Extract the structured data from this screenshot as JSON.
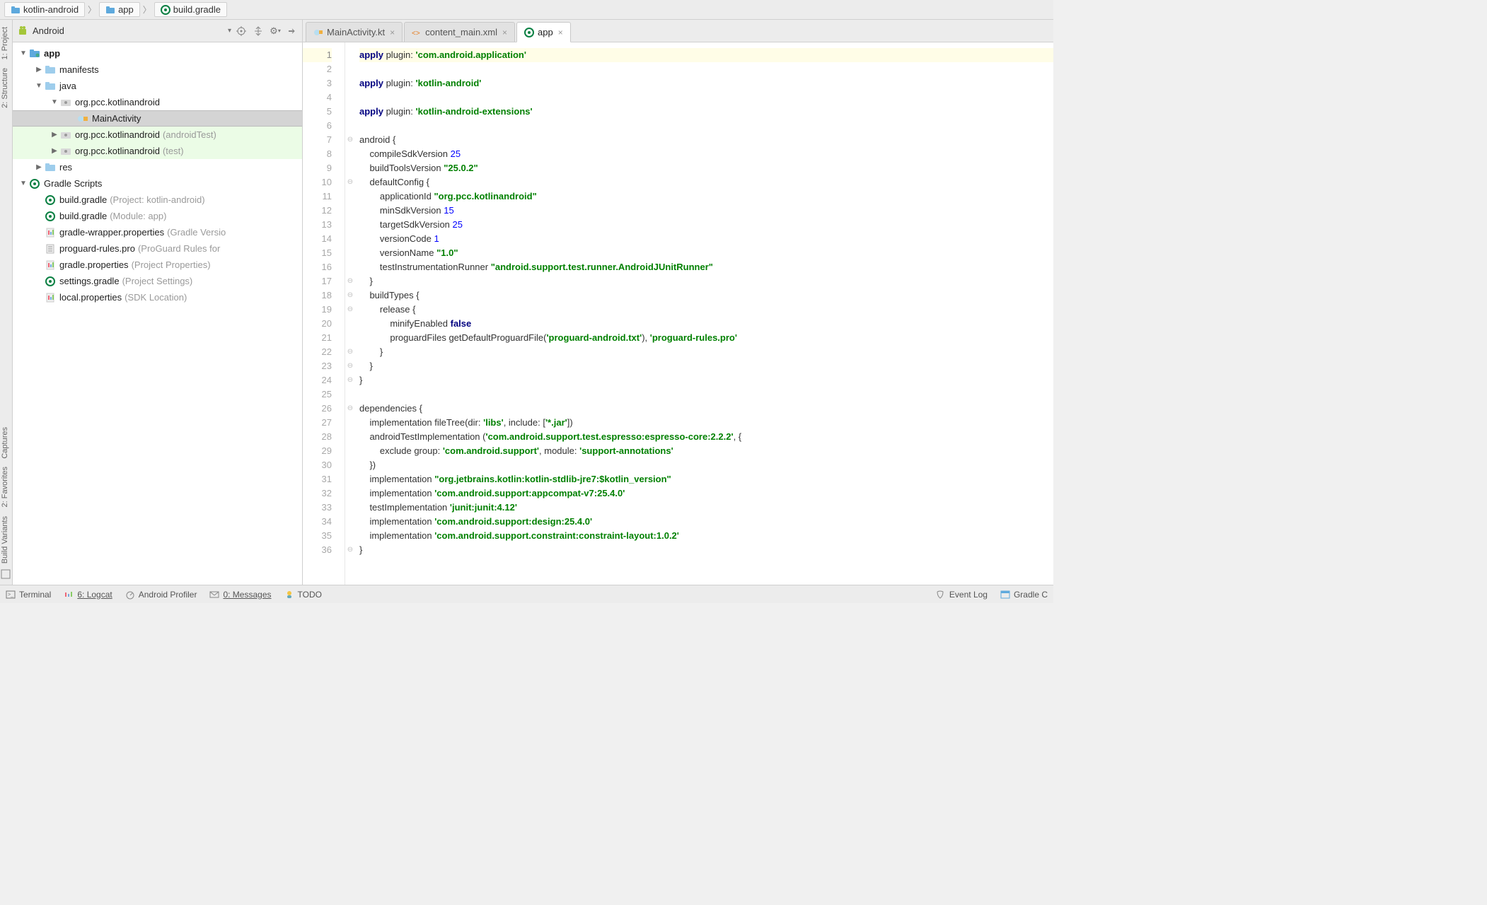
{
  "breadcrumbs": [
    {
      "label": "kotlin-android",
      "icon": "folder-blue"
    },
    {
      "label": "app",
      "icon": "folder-blue"
    },
    {
      "label": "build.gradle",
      "icon": "gradle"
    }
  ],
  "sidebar": {
    "dropdown_label": "Android",
    "toolbuttons": [
      "target-icon",
      "sync-icon",
      "gear-icon",
      "collapse-icon"
    ]
  },
  "tree": {
    "app": "app",
    "manifests": "manifests",
    "java": "java",
    "pkg_main": "org.pcc.kotlinandroid",
    "main_activity": "MainActivity",
    "pkg_androidTest": "org.pcc.kotlinandroid",
    "pkg_androidTest_suffix": "(androidTest)",
    "pkg_test": "org.pcc.kotlinandroid",
    "pkg_test_suffix": "(test)",
    "res": "res",
    "gradle_scripts": "Gradle Scripts",
    "build_project": "build.gradle",
    "build_project_suffix": "(Project: kotlin-android)",
    "build_module": "build.gradle",
    "build_module_suffix": "(Module: app)",
    "gradle_wrapper": "gradle-wrapper.properties",
    "gradle_wrapper_suffix": "(Gradle Versio",
    "proguard": "proguard-rules.pro",
    "proguard_suffix": "(ProGuard Rules for",
    "gradle_props": "gradle.properties",
    "gradle_props_suffix": "(Project Properties)",
    "settings_gradle": "settings.gradle",
    "settings_gradle_suffix": "(Project Settings)",
    "local_props": "local.properties",
    "local_props_suffix": "(SDK Location)"
  },
  "editor_tabs": [
    {
      "label": "MainActivity.kt",
      "icon": "kotlin",
      "active": false
    },
    {
      "label": "content_main.xml",
      "icon": "xml",
      "active": false
    },
    {
      "label": "app",
      "icon": "gradle",
      "active": true
    }
  ],
  "code": {
    "lines": [
      {
        "n": 1,
        "curr": true,
        "tokens": [
          [
            "apply ",
            "k"
          ],
          [
            "plugin",
            ""
          ],
          [
            ": ",
            ""
          ],
          [
            "'com.android.application'",
            "s"
          ]
        ]
      },
      {
        "n": 2,
        "tokens": [
          [
            "",
            ""
          ]
        ]
      },
      {
        "n": 3,
        "tokens": [
          [
            "apply ",
            "k"
          ],
          [
            "plugin",
            ""
          ],
          [
            ": ",
            ""
          ],
          [
            "'kotlin-android'",
            "s"
          ]
        ]
      },
      {
        "n": 4,
        "tokens": [
          [
            "",
            ""
          ]
        ]
      },
      {
        "n": 5,
        "tokens": [
          [
            "apply ",
            "k"
          ],
          [
            "plugin",
            ""
          ],
          [
            ": ",
            ""
          ],
          [
            "'kotlin-android-extensions'",
            "s"
          ]
        ]
      },
      {
        "n": 6,
        "tokens": [
          [
            "",
            ""
          ]
        ]
      },
      {
        "n": 7,
        "tokens": [
          [
            "android {",
            ""
          ]
        ]
      },
      {
        "n": 8,
        "tokens": [
          [
            "    compileSdkVersion ",
            ""
          ],
          [
            "25",
            "n"
          ]
        ]
      },
      {
        "n": 9,
        "tokens": [
          [
            "    buildToolsVersion ",
            ""
          ],
          [
            "\"25.0.2\"",
            "s"
          ]
        ]
      },
      {
        "n": 10,
        "tokens": [
          [
            "    defaultConfig {",
            ""
          ]
        ]
      },
      {
        "n": 11,
        "tokens": [
          [
            "        applicationId ",
            ""
          ],
          [
            "\"org.pcc.kotlinandroid\"",
            "s"
          ]
        ]
      },
      {
        "n": 12,
        "tokens": [
          [
            "        minSdkVersion ",
            ""
          ],
          [
            "15",
            "n"
          ]
        ]
      },
      {
        "n": 13,
        "tokens": [
          [
            "        targetSdkVersion ",
            ""
          ],
          [
            "25",
            "n"
          ]
        ]
      },
      {
        "n": 14,
        "tokens": [
          [
            "        versionCode ",
            ""
          ],
          [
            "1",
            "n"
          ]
        ]
      },
      {
        "n": 15,
        "tokens": [
          [
            "        versionName ",
            ""
          ],
          [
            "\"1.0\"",
            "s"
          ]
        ]
      },
      {
        "n": 16,
        "tokens": [
          [
            "        testInstrumentationRunner ",
            ""
          ],
          [
            "\"android.support.test.runner.AndroidJUnitRunner\"",
            "s"
          ]
        ]
      },
      {
        "n": 17,
        "tokens": [
          [
            "    }",
            ""
          ]
        ]
      },
      {
        "n": 18,
        "tokens": [
          [
            "    buildTypes {",
            ""
          ]
        ]
      },
      {
        "n": 19,
        "tokens": [
          [
            "        release {",
            ""
          ]
        ]
      },
      {
        "n": 20,
        "tokens": [
          [
            "            minifyEnabled ",
            ""
          ],
          [
            "false",
            "k"
          ]
        ]
      },
      {
        "n": 21,
        "tokens": [
          [
            "            proguardFiles getDefaultProguardFile(",
            ""
          ],
          [
            "'proguard-android.txt'",
            "s"
          ],
          [
            "), ",
            ""
          ],
          [
            "'proguard-rules.pro'",
            "s"
          ]
        ]
      },
      {
        "n": 22,
        "tokens": [
          [
            "        }",
            ""
          ]
        ]
      },
      {
        "n": 23,
        "tokens": [
          [
            "    }",
            ""
          ]
        ]
      },
      {
        "n": 24,
        "tokens": [
          [
            "}",
            ""
          ]
        ]
      },
      {
        "n": 25,
        "tokens": [
          [
            "",
            ""
          ]
        ]
      },
      {
        "n": 26,
        "tokens": [
          [
            "dependencies {",
            ""
          ]
        ]
      },
      {
        "n": 27,
        "tokens": [
          [
            "    implementation fileTree(",
            ""
          ],
          [
            "dir",
            ""
          ],
          [
            ": ",
            ""
          ],
          [
            "'libs'",
            "s"
          ],
          [
            ", ",
            ""
          ],
          [
            "include",
            ""
          ],
          [
            ": [",
            ""
          ],
          [
            "'*.jar'",
            "s"
          ],
          [
            "])",
            ""
          ]
        ]
      },
      {
        "n": 28,
        "tokens": [
          [
            "    androidTestImplementation (",
            ""
          ],
          [
            "'com.android.support.test.espresso:espresso-core:2.2.2'",
            "s"
          ],
          [
            ", {",
            ""
          ]
        ]
      },
      {
        "n": 29,
        "tokens": [
          [
            "        exclude ",
            ""
          ],
          [
            "group",
            ""
          ],
          [
            ": ",
            ""
          ],
          [
            "'com.android.support'",
            "s"
          ],
          [
            ", ",
            ""
          ],
          [
            "module",
            ""
          ],
          [
            ": ",
            ""
          ],
          [
            "'support-annotations'",
            "s"
          ]
        ]
      },
      {
        "n": 30,
        "tokens": [
          [
            "    })",
            ""
          ]
        ]
      },
      {
        "n": 31,
        "tokens": [
          [
            "    implementation ",
            ""
          ],
          [
            "\"org.jetbrains.kotlin:kotlin-stdlib-jre7:$kotlin_version\"",
            "s"
          ]
        ]
      },
      {
        "n": 32,
        "tokens": [
          [
            "    implementation ",
            ""
          ],
          [
            "'com.android.support:appcompat-v7:25.4.0'",
            "s"
          ]
        ]
      },
      {
        "n": 33,
        "tokens": [
          [
            "    testImplementation ",
            ""
          ],
          [
            "'junit:junit:4.12'",
            "s"
          ]
        ]
      },
      {
        "n": 34,
        "tokens": [
          [
            "    implementation ",
            ""
          ],
          [
            "'com.android.support:design:25.4.0'",
            "s"
          ]
        ]
      },
      {
        "n": 35,
        "tokens": [
          [
            "    implementation ",
            ""
          ],
          [
            "'com.android.support.constraint:constraint-layout:1.0.2'",
            "s"
          ]
        ]
      },
      {
        "n": 36,
        "tokens": [
          [
            "}",
            ""
          ]
        ]
      }
    ]
  },
  "status": {
    "terminal": "Terminal",
    "logcat": "6: Logcat",
    "profiler": "Android Profiler",
    "messages": "0: Messages",
    "todo": "TODO",
    "eventlog": "Event Log",
    "gradle": "Gradle C"
  },
  "lefttabs": {
    "project": "1: Project",
    "structure": "2: Structure",
    "captures": "Captures",
    "favorites": "2: Favorites",
    "buildv": "Build Variants"
  }
}
